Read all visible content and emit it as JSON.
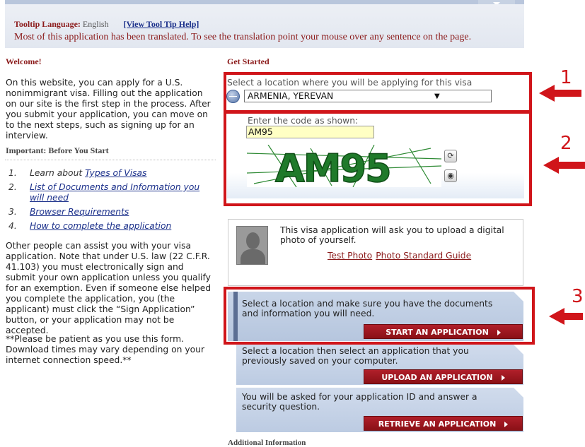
{
  "banner": {
    "tooltip_label": "Tooltip Language:",
    "tooltip_value": "English",
    "help_link": "[View Tool Tip Help]",
    "translation_note": "Most of this application has been translated. To see the translation point your mouse over any sentence on the page."
  },
  "left": {
    "welcome_title": "Welcome!",
    "intro": "On this website, you can apply for a U.S. nonimmigrant visa. Filling out the application on our site is the first step in the process. After you submit your application, you can move on to the next steps, such as signing up for an interview.",
    "important_title": "Important: Before You Start",
    "steps": [
      {
        "num": "1.",
        "prefix": "Learn about ",
        "link": "Types of Visas"
      },
      {
        "num": "2.",
        "prefix": "",
        "link": "List of Documents and Information you will need"
      },
      {
        "num": "3.",
        "prefix": "",
        "link": "Browser Requirements"
      },
      {
        "num": "4.",
        "prefix": "",
        "link": "How to complete the application"
      }
    ],
    "assist_para": "Other people can assist you with your visa application. Note that under U.S. law (22 C.F.R. 41.103) you must electronically sign and submit your own application unless you qualify for an exemption. Even if someone else helped you complete the application, you (the applicant) must click the “Sign Application” button, or your application may not be accepted.",
    "patience_para": "**Please be patient as you use this form. Download times may vary depending on your internet connection speed.**"
  },
  "right": {
    "get_started_title": "Get Started",
    "location_label": "Select a location where you will be applying for this visa",
    "location_value": "ARMENIA, YEREVAN",
    "code_label": "Enter the code as shown:",
    "code_value": "AM95",
    "captcha_text": "AM95",
    "photo_text": "This visa application will ask you to upload a digital photo of yourself.",
    "test_photo_link": "Test Photo",
    "photo_guide_link": "Photo Standard Guide",
    "panels": [
      {
        "text": "Select a location and make sure you have the documents and information you will need.",
        "button": "START AN APPLICATION"
      },
      {
        "text": "Select a location then select an application that you previously saved on your computer.",
        "button": "UPLOAD AN APPLICATION"
      },
      {
        "text": "You will be asked for your application ID and answer a security question.",
        "button": "RETRIEVE AN APPLICATION"
      }
    ],
    "additional_info": "Additional Information"
  },
  "annotations": {
    "n1": "1",
    "n2": "2",
    "n3": "3",
    "color": "#d0151a"
  }
}
